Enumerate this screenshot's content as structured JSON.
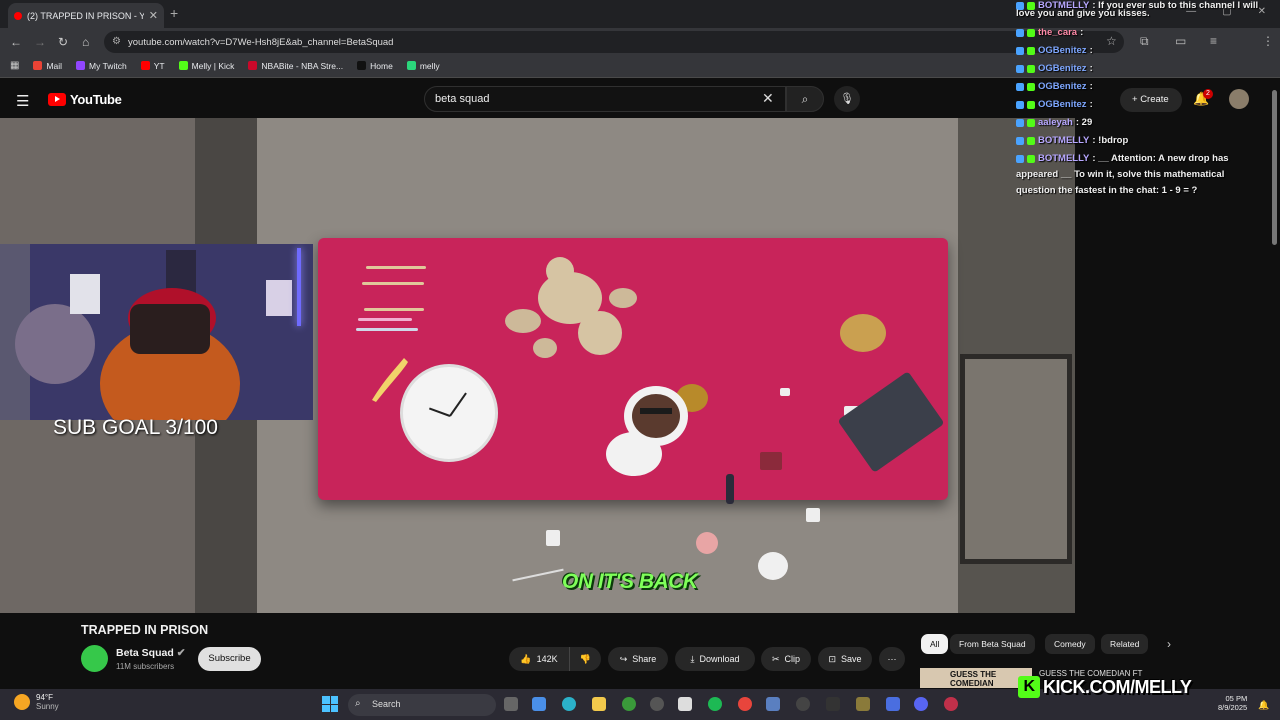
{
  "browser": {
    "tab_title": "(2) TRAPPED IN PRISON - Y",
    "url": "youtube.com/watch?v=D7We-Hsh8jE&ab_channel=BetaSquad",
    "bookmarks": [
      {
        "label": "Mail",
        "color": "#ea4335"
      },
      {
        "label": "My Twitch",
        "color": "#9146ff"
      },
      {
        "label": "YT",
        "color": "#ff0000"
      },
      {
        "label": "Melly | Kick",
        "color": "#53fc18"
      },
      {
        "label": "NBABite - NBA Stre...",
        "color": "#c9082a"
      },
      {
        "label": "Home",
        "color": "#111111"
      },
      {
        "label": "melly",
        "color": "#2bd67b"
      }
    ]
  },
  "youtube": {
    "logo_text": "YouTube",
    "search_query": "beta squad",
    "create_label": "Create",
    "notification_count": "2"
  },
  "video": {
    "subtitle": "ON IT'S BACK",
    "overlay_sub_goal": "SUB GOAL 3/100",
    "title": "TRAPPED IN PRISON",
    "channel_name": "Beta Squad",
    "subscribers": "11M subscribers",
    "subscribe_label": "Subscribe",
    "likes": "142K",
    "share_label": "Share",
    "download_label": "Download",
    "clip_label": "Clip",
    "save_label": "Save"
  },
  "chips": [
    "All",
    "From Beta Squad",
    "Comedy",
    "Related"
  ],
  "recommended": {
    "title": "GUESS THE COMEDIAN FT",
    "thumb_text": "GUESS THE COMEDIAN"
  },
  "chat": [
    {
      "user": "BOTMELLY",
      "message": ": If you ever sub to this channel I will",
      "cls": "u"
    },
    {
      "user": "",
      "message": "love you and give you kisses.",
      "cls": "msg"
    },
    {
      "user": "the_cara",
      "message": ":",
      "cls": "u3"
    },
    {
      "user": "OGBenitez",
      "message": ":",
      "cls": "u2"
    },
    {
      "user": "OGBenitez",
      "message": ":",
      "cls": "u2"
    },
    {
      "user": "OGBenitez",
      "message": ":",
      "cls": "u2"
    },
    {
      "user": "OGBenitez",
      "message": ":",
      "cls": "u2"
    },
    {
      "user": "aaleyah",
      "message": ": 29",
      "cls": "u"
    },
    {
      "user": "BOTMELLY",
      "message": ": !bdrop",
      "cls": "u"
    },
    {
      "user": "BOTMELLY",
      "message": ": __ Attention: A new drop has",
      "cls": "u"
    },
    {
      "user": "",
      "message": "appeared __ To win it, solve this mathematical",
      "cls": "msg"
    },
    {
      "user": "",
      "message": "question the fastest in the chat: 1 - 9 = ?",
      "cls": "msg"
    }
  ],
  "taskbar": {
    "temperature": "94°F",
    "weather": "Sunny",
    "search_placeholder": "Search",
    "time": "05 PM",
    "date": "8/9/2025",
    "kick_text": "KICK.COM/MELLY"
  }
}
